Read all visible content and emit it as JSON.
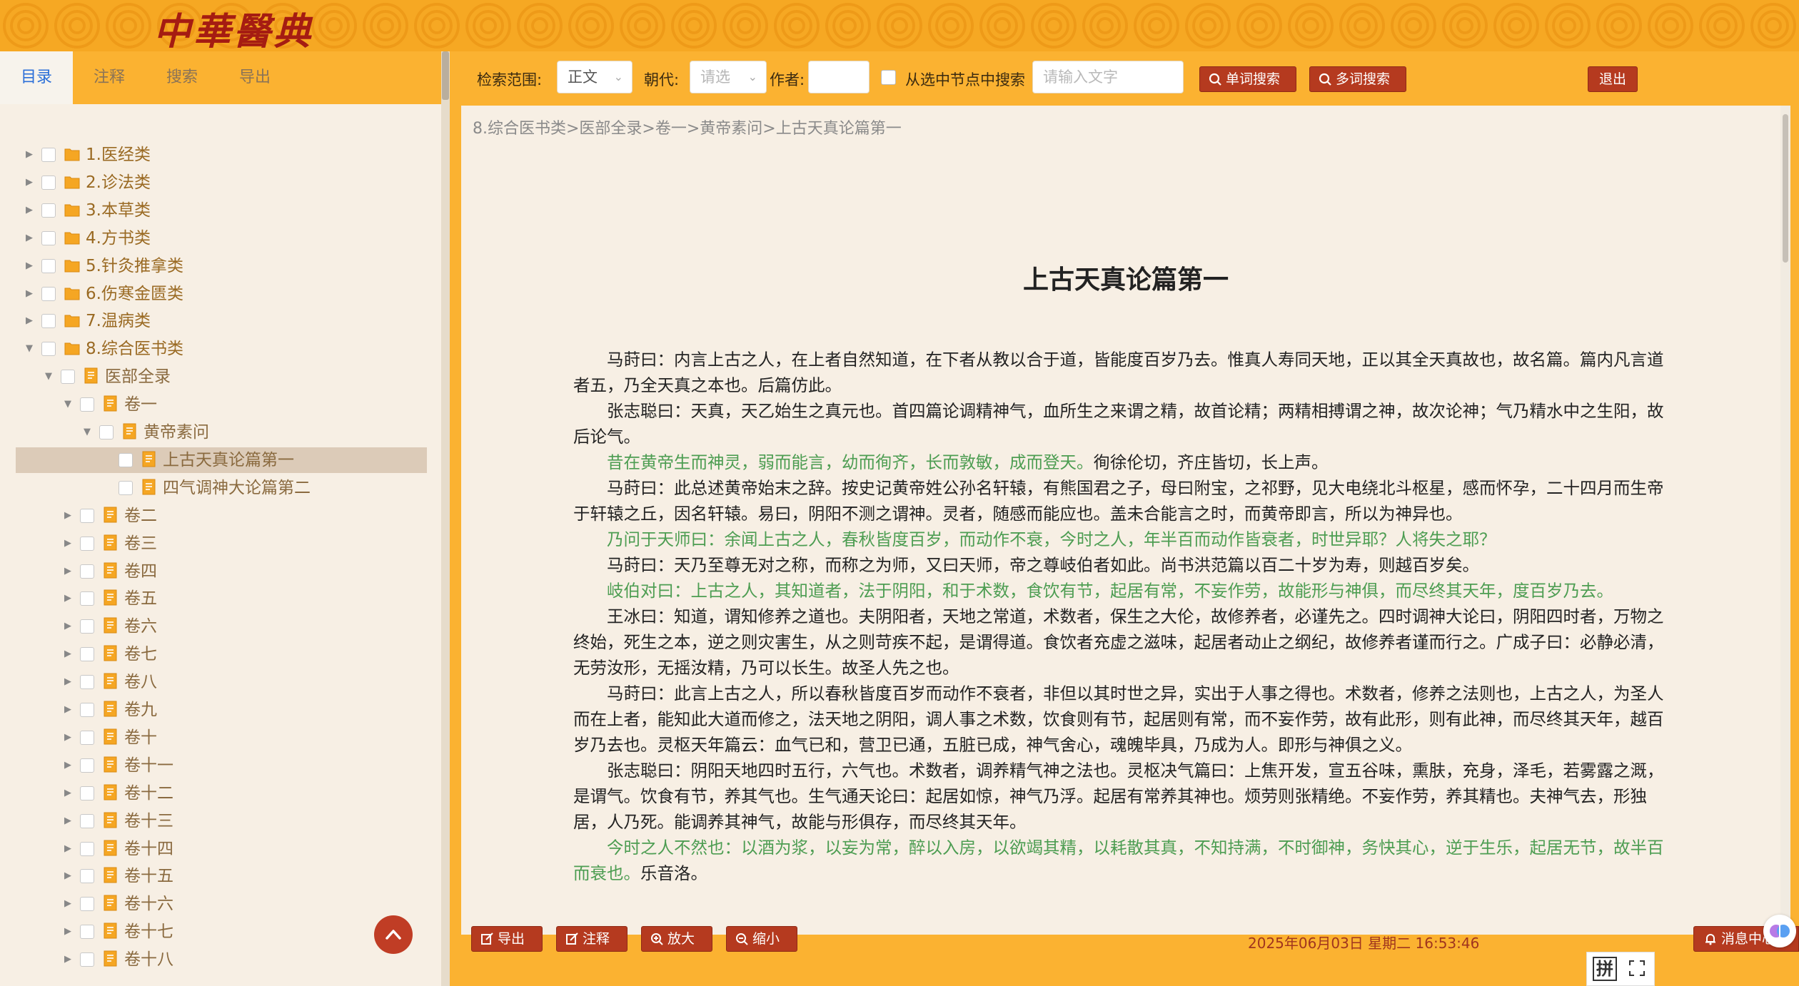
{
  "app": {
    "logo": "中華醫典"
  },
  "left_tabs": [
    "目录",
    "注释",
    "搜索",
    "导出"
  ],
  "tree": [
    {
      "label": "1.医经类",
      "level": 0,
      "type": "folder",
      "expand": "collapsed"
    },
    {
      "label": "2.诊法类",
      "level": 0,
      "type": "folder",
      "expand": "collapsed"
    },
    {
      "label": "3.本草类",
      "level": 0,
      "type": "folder",
      "expand": "collapsed"
    },
    {
      "label": "4.方书类",
      "level": 0,
      "type": "folder",
      "expand": "collapsed"
    },
    {
      "label": "5.针灸推拿类",
      "level": 0,
      "type": "folder",
      "expand": "collapsed"
    },
    {
      "label": "6.伤寒金匮类",
      "level": 0,
      "type": "folder",
      "expand": "collapsed"
    },
    {
      "label": "7.温病类",
      "level": 0,
      "type": "folder",
      "expand": "collapsed"
    },
    {
      "label": "8.综合医书类",
      "level": 0,
      "type": "folder",
      "expand": "expanded"
    },
    {
      "label": "医部全录",
      "level": 1,
      "type": "book",
      "expand": "expanded"
    },
    {
      "label": "卷一",
      "level": 2,
      "type": "book",
      "expand": "expanded"
    },
    {
      "label": "黄帝素问",
      "level": 3,
      "type": "book",
      "expand": "expanded"
    },
    {
      "label": "上古天真论篇第一",
      "level": 4,
      "type": "book",
      "expand": "none",
      "selected": true
    },
    {
      "label": "四气调神大论篇第二",
      "level": 4,
      "type": "book",
      "expand": "none"
    },
    {
      "label": "卷二",
      "level": 2,
      "type": "book",
      "expand": "collapsed"
    },
    {
      "label": "卷三",
      "level": 2,
      "type": "book",
      "expand": "collapsed"
    },
    {
      "label": "卷四",
      "level": 2,
      "type": "book",
      "expand": "collapsed"
    },
    {
      "label": "卷五",
      "level": 2,
      "type": "book",
      "expand": "collapsed"
    },
    {
      "label": "卷六",
      "level": 2,
      "type": "book",
      "expand": "collapsed"
    },
    {
      "label": "卷七",
      "level": 2,
      "type": "book",
      "expand": "collapsed"
    },
    {
      "label": "卷八",
      "level": 2,
      "type": "book",
      "expand": "collapsed"
    },
    {
      "label": "卷九",
      "level": 2,
      "type": "book",
      "expand": "collapsed"
    },
    {
      "label": "卷十",
      "level": 2,
      "type": "book",
      "expand": "collapsed"
    },
    {
      "label": "卷十一",
      "level": 2,
      "type": "book",
      "expand": "collapsed"
    },
    {
      "label": "卷十二",
      "level": 2,
      "type": "book",
      "expand": "collapsed"
    },
    {
      "label": "卷十三",
      "level": 2,
      "type": "book",
      "expand": "collapsed"
    },
    {
      "label": "卷十四",
      "level": 2,
      "type": "book",
      "expand": "collapsed"
    },
    {
      "label": "卷十五",
      "level": 2,
      "type": "book",
      "expand": "collapsed"
    },
    {
      "label": "卷十六",
      "level": 2,
      "type": "book",
      "expand": "collapsed"
    },
    {
      "label": "卷十七",
      "level": 2,
      "type": "book",
      "expand": "collapsed"
    },
    {
      "label": "卷十八",
      "level": 2,
      "type": "book",
      "expand": "collapsed"
    }
  ],
  "toolbar": {
    "scope_label": "检索范围:",
    "scope_value": "正文",
    "dynasty_label": "朝代:",
    "dynasty_placeholder": "请选",
    "author_label": "作者:",
    "author_value": "",
    "node_search_label": "从选中节点中搜索",
    "search_placeholder": "请输入文字",
    "single_search": "单词搜索",
    "multi_search": "多词搜索",
    "exit": "退出"
  },
  "breadcrumb": "8.综合医书类>医部全录>卷一>黄帝素问>上古天真论篇第一",
  "document": {
    "title": "上古天真论篇第一",
    "paragraphs": [
      [
        {
          "t": "马莳曰：内言上古之人，在上者自然知道，在下者从教以合于道，皆能度百岁乃去。惟真人寿同天地，正以其全天真故也，故名篇。篇内凡言道者五，乃全天真之本也。后篇仿此。",
          "g": false
        }
      ],
      [
        {
          "t": "张志聪曰：天真，天乙始生之真元也。首四篇论调精神气，血所生之来谓之精，故首论精；两精相搏谓之神，故次论神；气乃精水中之生阳，故后论气。",
          "g": false
        }
      ],
      [
        {
          "t": "昔在黄帝生而神灵，弱而能言，幼而徇齐，长而敦敏，成而登天。",
          "g": true
        },
        {
          "t": "徇徐伦切，齐庄皆切，长上声。",
          "g": false
        }
      ],
      [
        {
          "t": "马莳曰：此总述黄帝始末之辞。按史记黄帝姓公孙名轩辕，有熊国君之子，母曰附宝，之祁野，见大电绕北斗枢星，感而怀孕，二十四月而生帝于轩辕之丘，因名轩辕。易曰，阴阳不测之谓神。灵者，随感而能应也。盖未合能言之时，而黄帝即言，所以为神异也。",
          "g": false
        }
      ],
      [
        {
          "t": "乃问于天师曰：余闻上古之人，春秋皆度百岁，而动作不衰，今时之人，年半百而动作皆衰者，时世异耶？人将失之耶？",
          "g": true
        }
      ],
      [
        {
          "t": "马莳曰：天乃至尊无对之称，而称之为师，又曰天师，帝之尊岐伯者如此。尚书洪范篇以百二十岁为寿，则越百岁矣。",
          "g": false
        }
      ],
      [
        {
          "t": "岐伯对曰：上古之人，其知道者，法于阴阳，和于术数，食饮有节，起居有常，不妄作劳，故能形与神俱，而尽终其天年，度百岁乃去。",
          "g": true
        }
      ],
      [
        {
          "t": "王冰曰：知道，谓知修养之道也。夫阴阳者，天地之常道，术数者，保生之大伦，故修养者，必谨先之。四时调神大论曰，阴阳四时者，万物之终始，死生之本，逆之则灾害生，从之则苛疾不起，是谓得道。食饮者充虚之滋味，起居者动止之纲纪，故修养者谨而行之。广成子曰：必静必清，无劳汝形，无摇汝精，乃可以长生。故圣人先之也。",
          "g": false
        }
      ],
      [
        {
          "t": "马莳曰：此言上古之人，所以春秋皆度百岁而动作不衰者，非但以其时世之异，实出于人事之得也。术数者，修养之法则也，上古之人，为圣人而在上者，能知此大道而修之，法天地之阴阳，调人事之术数，饮食则有节，起居则有常，而不妄作劳，故有此形，则有此神，而尽终其天年，越百岁乃去也。灵枢天年篇云：血气已和，营卫已通，五脏已成，神气舍心，魂魄毕具，乃成为人。即形与神俱之义。",
          "g": false
        }
      ],
      [
        {
          "t": "张志聪曰：阴阳天地四时五行，六气也。术数者，调养精气神之法也。灵枢决气篇曰：上焦开发，宣五谷味，熏肤，充身，泽毛，若雾露之溉，是谓气。饮食有节，养其气也。生气通天论曰：起居如惊，神气乃浮。起居有常养其神也。烦劳则张精绝。不妄作劳，养其精也。夫神气去，形独居，人乃死。能调养其神气，故能与形俱存，而尽终其天年。",
          "g": false
        }
      ],
      [
        {
          "t": "今时之人不然也：以酒为浆，以妄为常，醉以入房，以欲竭其精，以耗散其真，不知持满，不时御神，务快其心，逆于生乐，起居无节，故半百而衰也。",
          "g": true
        },
        {
          "t": "乐音洛。",
          "g": false
        }
      ]
    ]
  },
  "bottom": {
    "export": "导出",
    "annotate": "注释",
    "zoom_in": "放大",
    "zoom_out": "缩小",
    "datetime": "2025年06月03日 星期二 16:53:46",
    "message": "消息中心"
  },
  "ime": {
    "label": "拼"
  },
  "colors": {
    "accent": "#fbb231",
    "button": "#b53a1f",
    "green_text": "#4d9d52",
    "tab_active": "#2b6fd8"
  }
}
